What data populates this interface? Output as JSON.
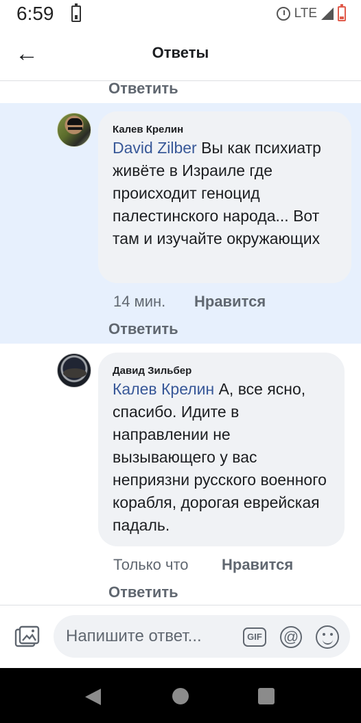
{
  "status": {
    "time": "6:59",
    "network": "LTE"
  },
  "header": {
    "back_icon": "←",
    "title": "Ответы"
  },
  "replies": [
    {
      "author": "Калев Крелин",
      "mention": "David Zilber",
      "text": " Вы как психиатр живёте в Израиле где происходит геноцид палестинского народа... Вот там и изучайте окружающих",
      "time": "14 мин.",
      "like_label": "Нравится",
      "reply_label": "Ответить"
    },
    {
      "author": "Давид Зильбер",
      "mention": "Калев Крелин",
      "text": " А, все ясно, спасибо. Идите в направлении не вызывающего у вас неприязни русского военного корабля, дорогая еврейская падаль.",
      "time": "Только что",
      "like_label": "Нравится",
      "reply_label": "Ответить"
    }
  ],
  "top_reply_label": "Ответить",
  "composer": {
    "placeholder": "Напишите ответ...",
    "gif_label": "GIF",
    "at_symbol": "@"
  },
  "colors": {
    "highlight": "#e7f0fd",
    "mention": "#385898",
    "secondary_text": "#606770"
  },
  "icons": {
    "photo": "photo-icon",
    "gif": "gif-icon",
    "mention": "at-icon",
    "emoji": "smile-icon"
  }
}
